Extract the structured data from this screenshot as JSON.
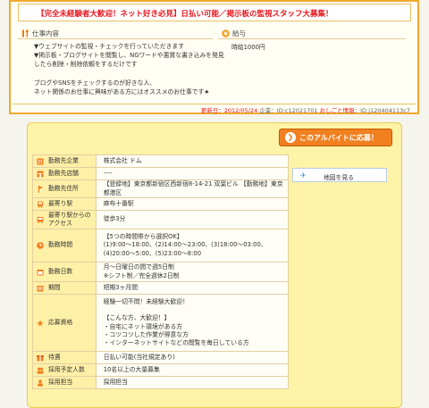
{
  "header": {
    "title": "【完全未経験者大歓迎！ネット好き必見】日払い可能／掲示板の監視スタッフ大募集！"
  },
  "job_content": {
    "heading": "仕事内容",
    "lines": [
      "▼ウェブサイトの監視・チェックを行っていただきます",
      "▼掲示板・ブログサイトを閲覧し、NGワードや悪質な書き込みを発見",
      "したら削除・削除依頼をするだけです",
      "",
      "ブログやSNSをチェックするのが好きな人、",
      "ネット関係のお仕事に興味がある方にはオススメのお仕事です★"
    ]
  },
  "salary": {
    "heading": "給与",
    "value": "時給1000円"
  },
  "meta": {
    "updated": "更新日：2012/05/24",
    "company_id": "企業：ID:c12021701",
    "ad_id_label": "おしごと情報",
    "ad_id": "：ID:j120404113c7"
  },
  "apply_button": {
    "label": "このアルバイトに応募！"
  },
  "map_button": {
    "label": "地図を見る"
  },
  "info_rows": [
    {
      "label": "勤務先企業",
      "value": "株式会社 ドム"
    },
    {
      "label": "勤務先店舗",
      "value": "----"
    },
    {
      "label": "勤務先住所",
      "value": "【登録地】東京都新宿区西新宿8-14-21 双葉ビル 【勤務地】東京都港区"
    },
    {
      "label": "最寄り駅",
      "value": "麻布十番駅"
    },
    {
      "label": "最寄り駅からのアクセス",
      "value": "徒歩3分"
    },
    {
      "label": "勤務時間",
      "value": "【5つの時間帯から選択OK】\n(1)9:00～18:00、(2)14:00～23:00、(3)18:00～03:00、\n(4)20:00～5:00、(5)23:00～8:00"
    },
    {
      "label": "勤務日数",
      "value": "月～日曜日の間で週5日制\n※シフト制／完全週休2日制"
    },
    {
      "label": "期間",
      "value": "短期3ヶ月間"
    },
    {
      "label": "応募資格",
      "value": "経験一切不問！未経験大歓迎！\n\n【こんな方、大歓迎！】\n・自宅にネット環境がある方\n・コツコツした作業が得意な方\n・インターネットサイトなどの閲覧を毎日している方"
    },
    {
      "label": "待遇",
      "value": "日払い可能(当社規定あり)"
    },
    {
      "label": "採用予定人数",
      "value": "10名以上の大量募集"
    },
    {
      "label": "採用担当",
      "value": "採用担当"
    }
  ],
  "colors": {
    "accent_orange": "#f08020",
    "title_red": "#e8161e",
    "border_gold": "#f0a830",
    "panel_yellow": "#fff3a8"
  }
}
